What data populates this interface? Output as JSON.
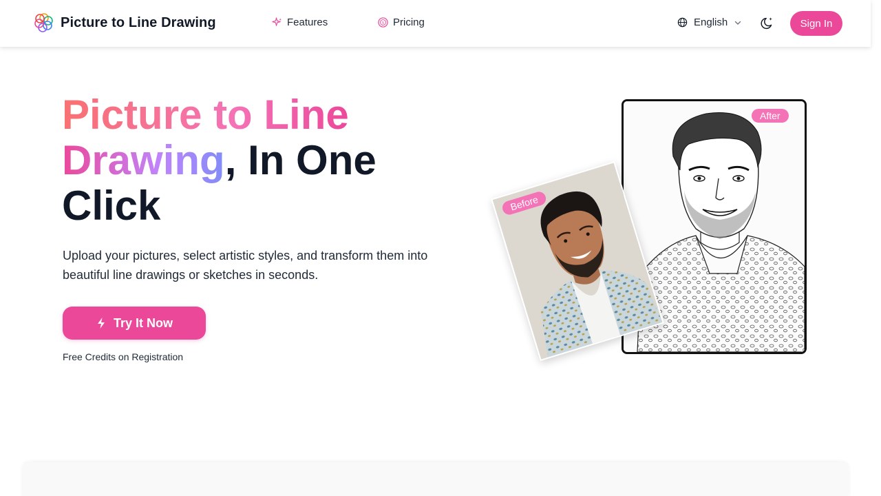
{
  "header": {
    "brand_name": "Picture to Line Drawing",
    "logo_icon": "flower-logo-icon",
    "nav": [
      {
        "label": "Features",
        "icon": "sparkles-icon"
      },
      {
        "label": "Pricing",
        "icon": "coin-icon"
      }
    ],
    "language": {
      "label": "English",
      "icon": "globe-icon"
    },
    "theme_toggle_icon": "moon-icon",
    "sign_in_label": "Sign In"
  },
  "hero": {
    "title_part1": "Picture to Line",
    "title_part2": "Drawing",
    "title_part3": ", In One Click",
    "description": "Upload your pictures, select artistic styles, and transform them into beautiful line drawings or sketches in seconds.",
    "cta_label": "Try It Now",
    "cta_icon": "lightning-icon",
    "cta_note": "Free Credits on Registration"
  },
  "showcase": {
    "before_label": "Before",
    "after_label": "After"
  },
  "colors": {
    "accent": "#ec4899",
    "tag": "#f472b6"
  }
}
